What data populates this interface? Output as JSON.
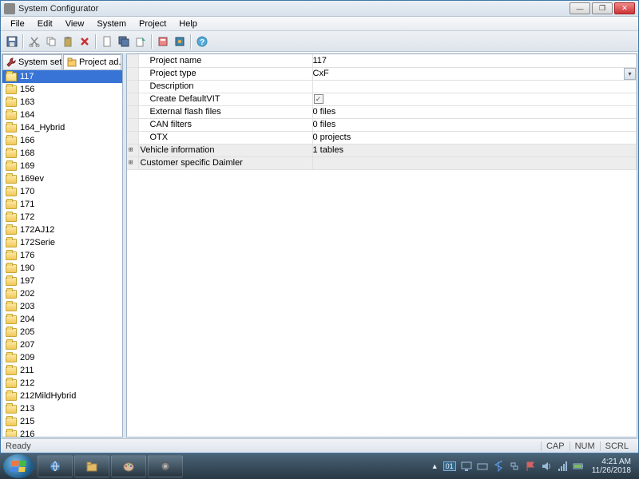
{
  "window": {
    "title": "System Configurator"
  },
  "menu": {
    "file": "File",
    "edit": "Edit",
    "view": "View",
    "system": "System",
    "project": "Project",
    "help": "Help"
  },
  "tabs": {
    "systemSettings": "System sett...",
    "projectAdmin": "Project ad..."
  },
  "tree": {
    "items": [
      "117",
      "156",
      "163",
      "164",
      "164_Hybrid",
      "166",
      "168",
      "169",
      "169ev",
      "170",
      "171",
      "172",
      "172AJ12",
      "172Serie",
      "176",
      "190",
      "197",
      "202",
      "203",
      "204",
      "205",
      "207",
      "209",
      "211",
      "212",
      "212MildHybrid",
      "213",
      "215",
      "216"
    ],
    "selected": "117"
  },
  "props": {
    "project_name": {
      "label": "Project name",
      "value": "117"
    },
    "project_type": {
      "label": "Project type",
      "value": "CxF"
    },
    "description": {
      "label": "Description",
      "value": ""
    },
    "create_default_vit": {
      "label": "Create DefaultVIT",
      "checked": true
    },
    "external_flash": {
      "label": "External flash files",
      "value": "0 files"
    },
    "can_filters": {
      "label": "CAN filters",
      "value": "0 files"
    },
    "otx": {
      "label": "OTX",
      "value": "0 projects"
    },
    "vehicle_info": {
      "label": "Vehicle information",
      "value": "1 tables"
    },
    "customer": {
      "label": "Customer specific Daimler",
      "value": ""
    }
  },
  "status": {
    "ready": "Ready",
    "caps": "CAP",
    "num": "NUM",
    "scroll": "SCRL"
  },
  "tray": {
    "lang": "01",
    "time": "4:21 AM",
    "date": "11/26/2018"
  }
}
